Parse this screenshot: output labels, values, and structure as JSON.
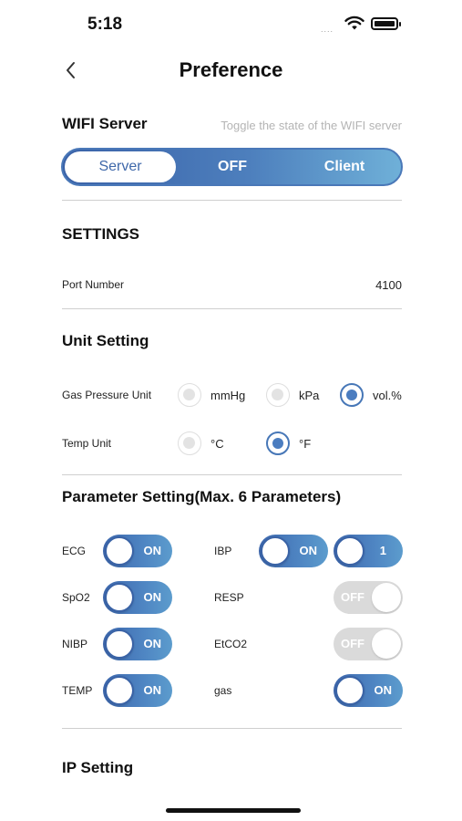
{
  "status_bar": {
    "time": "5:18",
    "signal": "....",
    "wifi_icon": "wifi-icon",
    "battery_icon": "battery-icon"
  },
  "nav": {
    "title": "Preference",
    "back_icon": "chevron-left-icon"
  },
  "wifi_server": {
    "title": "WIFI Server",
    "hint": "Toggle the state of the WIFI server",
    "options": [
      "Server",
      "OFF",
      "Client"
    ],
    "selected": "Server"
  },
  "settings": {
    "title": "SETTINGS",
    "port_label": "Port Number",
    "port_value": "4100"
  },
  "unit_setting": {
    "title": "Unit Setting",
    "gas_label": "Gas Pressure Unit",
    "gas_options": [
      "mmHg",
      "kPa",
      "vol.%"
    ],
    "gas_selected": "vol.%",
    "temp_label": "Temp Unit",
    "temp_options": [
      "°C",
      "°F"
    ],
    "temp_selected": "°F"
  },
  "parameter_setting": {
    "title": "Parameter Setting(Max. 6 Parameters)",
    "params": [
      {
        "label": "ECG",
        "state": "ON"
      },
      {
        "label": "IBP",
        "state": "ON",
        "extra": "1"
      },
      {
        "label": "SpO2",
        "state": "ON"
      },
      {
        "label": "RESP",
        "state": "OFF"
      },
      {
        "label": "NIBP",
        "state": "ON"
      },
      {
        "label": "EtCO2",
        "state": "OFF"
      },
      {
        "label": "TEMP",
        "state": "ON"
      },
      {
        "label": "gas",
        "state": "ON"
      }
    ]
  },
  "ip_setting": {
    "title": "IP Setting"
  },
  "colors": {
    "accent": "#4777b7",
    "gradient_start": "#3a62a8",
    "gradient_end": "#6fb0d8",
    "off_gray": "#dadada"
  }
}
